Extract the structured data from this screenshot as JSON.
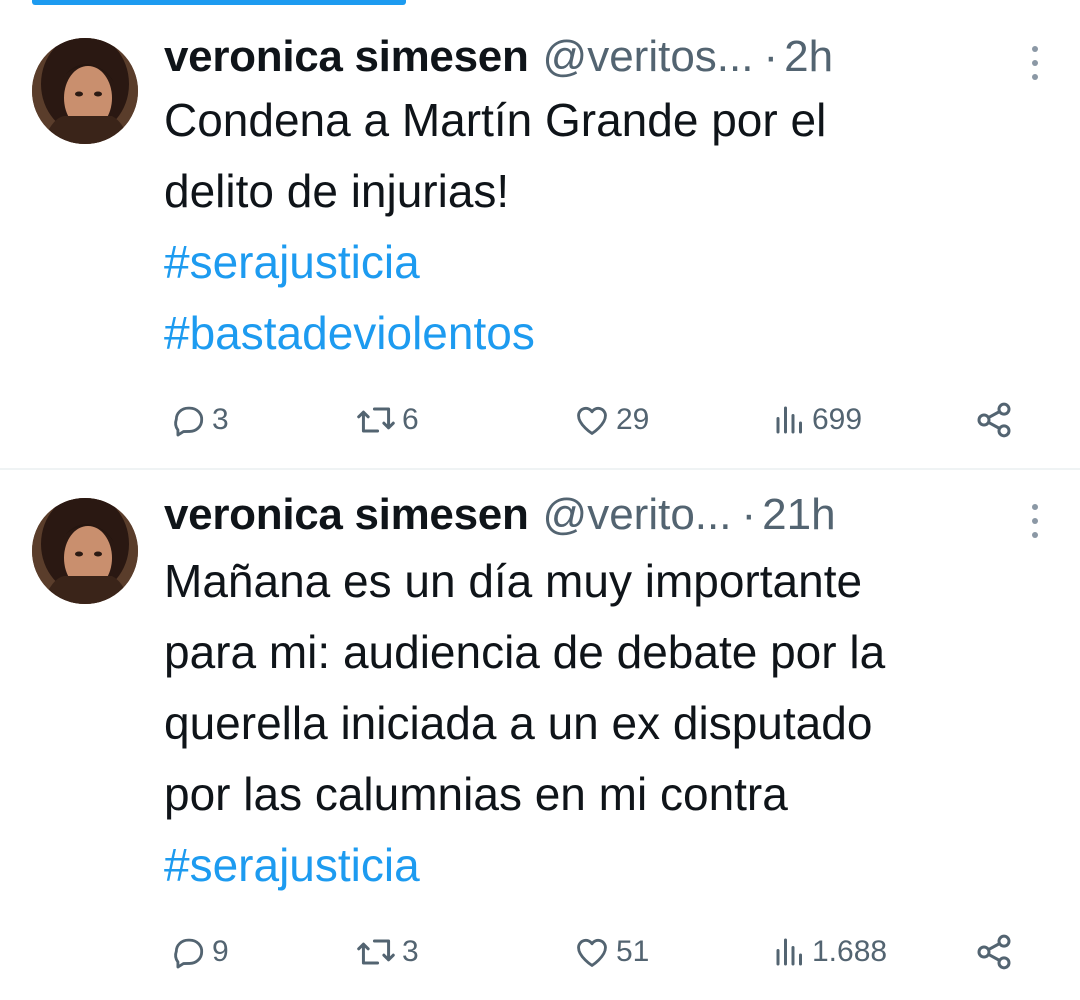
{
  "tweets": [
    {
      "author": {
        "name": "veronica simesen",
        "handle": "@veritos...",
        "avatar": "profile-photo"
      },
      "time": "2h",
      "text_lines": [
        "Condena a Martín Grande por el",
        "delito de injurias!"
      ],
      "hashtags": [
        "#serajusticia",
        "#bastadeviolentos"
      ],
      "stats": {
        "replies": "3",
        "retweets": "6",
        "likes": "29",
        "views": "699"
      }
    },
    {
      "author": {
        "name": "veronica simesen",
        "handle": "@verito...",
        "avatar": "profile-photo"
      },
      "time": "21h",
      "text_lines": [
        "Mañana es un día muy importante",
        "para mi: audiencia de debate por la",
        "querella iniciada a un ex disputado",
        "por las calumnias en mi contra"
      ],
      "hashtags": [
        "#serajusticia"
      ],
      "stats": {
        "replies": "9",
        "retweets": "3",
        "likes": "51",
        "views": "1.688"
      }
    }
  ],
  "icons": [
    "more-icon",
    "reply-icon",
    "retweet-icon",
    "like-icon",
    "views-icon",
    "share-icon"
  ],
  "colors": {
    "accent": "#1d9bf0",
    "text": "#0f1419",
    "muted": "#536471",
    "divider": "#eff3f4"
  }
}
